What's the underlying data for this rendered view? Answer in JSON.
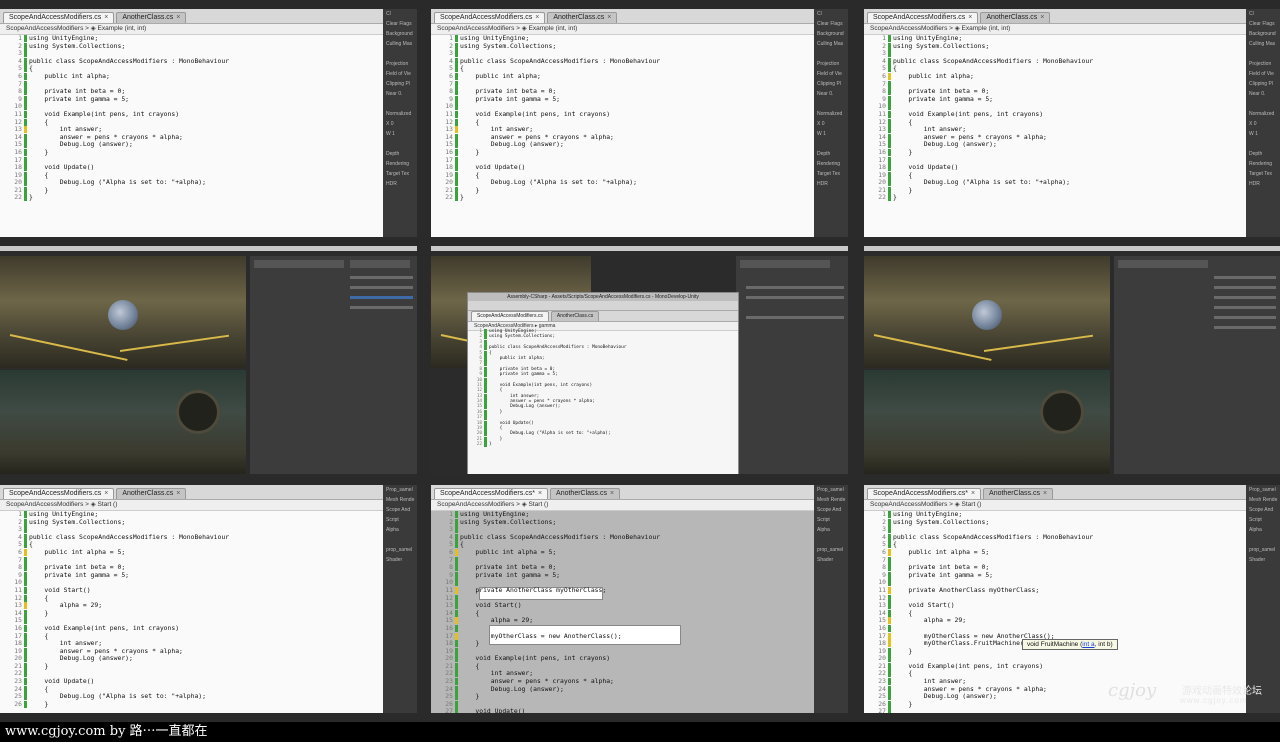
{
  "tabs": {
    "scope": "ScopeAndAccessModifiers.cs",
    "scope_modified": "ScopeAndAccessModifiers.cs*",
    "another": "AnotherClass.cs"
  },
  "crumbs": {
    "example": "ScopeAndAccessModifiers > ◈ Example (int, int)",
    "start": "ScopeAndAccessModifiers > ◈ Start ()",
    "gamma": "ScopeAndAccessModifiers ▸ gamma"
  },
  "code_a": [
    "using UnityEngine;",
    "using System.Collections;",
    "",
    "public class ScopeAndAccessModifiers : MonoBehaviour",
    "{",
    "    public int alpha;",
    "",
    "    private int beta = 0;",
    "    private int gamma = 5;",
    "",
    "    void Example(int pens, int crayons)",
    "    {",
    "        int answer;",
    "        answer = pens * crayons * alpha;",
    "        Debug.Log (answer);",
    "    }",
    "",
    "    void Update()",
    "    {",
    "        Debug.Log (\"Alpha is set to: \"+alpha);",
    "    }",
    "}"
  ],
  "code_b": [
    "using UnityEngine;",
    "using System.Collections;",
    "",
    "public class ScopeAndAccessModifiers : MonoBehaviour",
    "{",
    "    public int alpha = 5;",
    "",
    "    private int beta = 0;",
    "    private int gamma = 5;",
    "",
    "    void Start()",
    "    {",
    "        alpha = 29;",
    "    }",
    "",
    "    void Example(int pens, int crayons)",
    "    {",
    "        int answer;",
    "        answer = pens * crayons * alpha;",
    "        Debug.Log (answer);",
    "    }",
    "",
    "    void Update()",
    "    {",
    "        Debug.Log (\"Alpha is set to: \"+alpha);",
    "    }"
  ],
  "code_c": [
    "using UnityEngine;",
    "using System.Collections;",
    "",
    "public class ScopeAndAccessModifiers : MonoBehaviour",
    "{",
    "    public int alpha = 5;",
    "",
    "    private int beta = 0;",
    "    private int gamma = 5;",
    "",
    "    private AnotherClass myOtherClass;",
    "",
    "    void Start()",
    "    {",
    "        alpha = 29;",
    "",
    "        myOtherClass = new AnotherClass();",
    "    }",
    "",
    "    void Example(int pens, int crayons)",
    "    {",
    "        int answer;",
    "        answer = pens * crayons * alpha;",
    "        Debug.Log (answer);",
    "    }",
    "",
    "    void Update()"
  ],
  "code_d": [
    "using UnityEngine;",
    "using System.Collections;",
    "",
    "public class ScopeAndAccessModifiers : MonoBehaviour",
    "{",
    "    public int alpha = 5;",
    "",
    "    private int beta = 0;",
    "    private int gamma = 5;",
    "",
    "    private AnotherClass myOtherClass;",
    "",
    "    void Start()",
    "    {",
    "        alpha = 29;",
    "",
    "        myOtherClass = new AnotherClass();",
    "        myOtherClass.FruitMachine(",
    "    }",
    "",
    "    void Example(int pens, int crayons)",
    "    {",
    "        int answer;",
    "        answer = pens * crayons * alpha;",
    "        Debug.Log (answer);",
    "    }",
    "",
    "    void Update()"
  ],
  "side_a": [
    "Cl",
    "Clear Flags",
    "Background",
    "Culling Mas",
    "",
    "Projection",
    "Field of Vie",
    "Clipping Pl",
    "Near 0.",
    "",
    "Normalized",
    "X 0",
    "W 1",
    "",
    "Depth",
    "Rendering",
    "Target Tex",
    "HDR"
  ],
  "side_b": [
    "Prop_samel",
    "Mesh Rende",
    "Scope And",
    "Script",
    "Alpha",
    "",
    "prop_samel",
    "Shader"
  ],
  "window_title": "Assembly-CSharp - Assets/Scripts/ScopeAndAccessModifiers.cs - MonoDevelop-Unity",
  "tooltip": {
    "pre": "void FruitMachine (",
    "u": "int a",
    "post": ", int b)"
  },
  "footer": "www.cgjoy.com by 路⋯一直都在",
  "watermark": {
    "logo": "cgjoy",
    "cn": "游戏动画特效论坛",
    "url": "www.cgjoy.com"
  }
}
